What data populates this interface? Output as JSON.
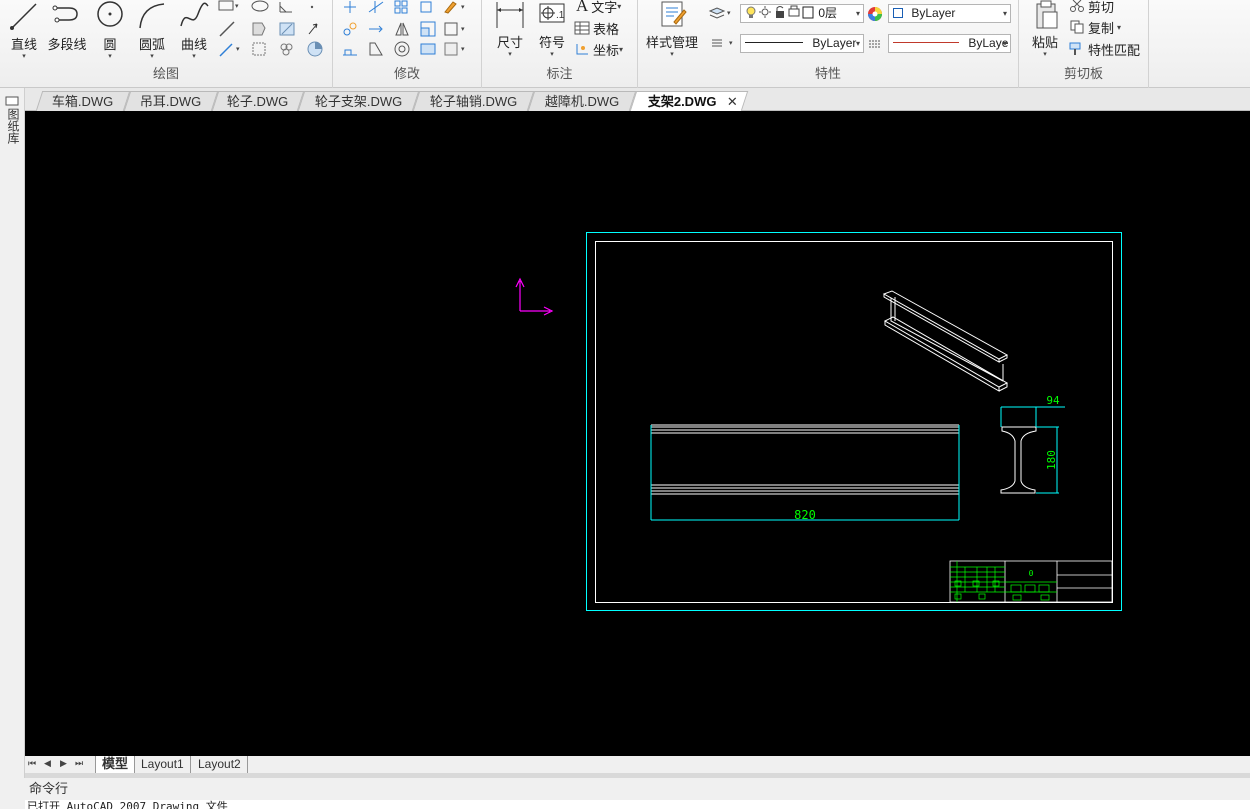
{
  "ribbon": {
    "draw": {
      "title": "绘图",
      "line": "直线",
      "polyline": "多段线",
      "circle": "圆",
      "arc": "圆弧",
      "curve": "曲线"
    },
    "modify": {
      "title": "修改"
    },
    "annotate": {
      "title": "标注",
      "dimension": "尺寸",
      "symbol": "符号",
      "text": "文字",
      "table": "表格",
      "coordinate": "坐标"
    },
    "properties": {
      "title": "特性",
      "style_manager": "样式管理",
      "layer_value": "0层",
      "color_value": "ByLayer",
      "linetype_value": "ByLayer",
      "lineweight_value": "ByLaye"
    },
    "clipboard": {
      "title": "剪切板",
      "paste": "粘贴",
      "cut": "剪切",
      "copy": "复制",
      "match_prop": "特性匹配"
    }
  },
  "left_strip": {
    "label": "图纸库"
  },
  "doc_tabs": [
    {
      "label": "车箱.DWG"
    },
    {
      "label": "吊耳.DWG"
    },
    {
      "label": "轮子.DWG"
    },
    {
      "label": "轮子支架.DWG"
    },
    {
      "label": "轮子轴销.DWG"
    },
    {
      "label": "越障机.DWG"
    },
    {
      "label": "支架2.DWG"
    }
  ],
  "drawing": {
    "dim_length": "820",
    "dim_width": "94",
    "dim_height": "180",
    "title_block_text": "0"
  },
  "layout_tabs": [
    {
      "label": "模型"
    },
    {
      "label": "Layout1"
    },
    {
      "label": "Layout2"
    }
  ],
  "command": {
    "header": "命令行",
    "output": "已打开 AutoCAD 2007 Drawing 文件"
  },
  "colors": {
    "canvas": "#000000",
    "frame_cyan": "#00ffff",
    "dim_green": "#00ff00",
    "ucs_magenta": "#ff00ff",
    "color_swatch_border": "#1a5fb4",
    "lineweight_red": "#c0392b"
  }
}
